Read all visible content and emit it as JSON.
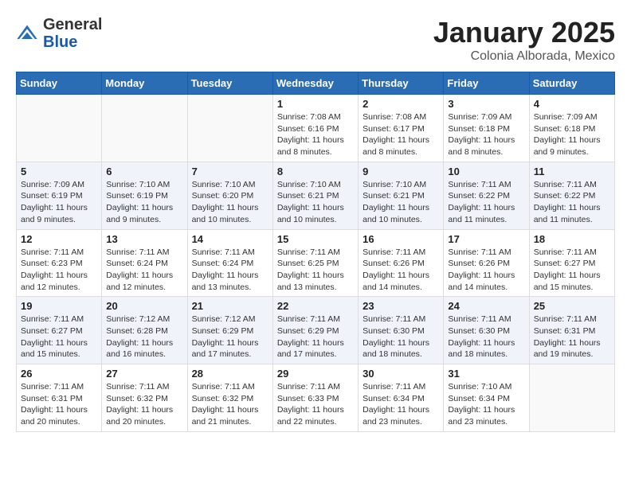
{
  "logo": {
    "general": "General",
    "blue": "Blue"
  },
  "title": "January 2025",
  "subtitle": "Colonia Alborada, Mexico",
  "weekdays": [
    "Sunday",
    "Monday",
    "Tuesday",
    "Wednesday",
    "Thursday",
    "Friday",
    "Saturday"
  ],
  "weeks": [
    [
      {
        "day": "",
        "info": ""
      },
      {
        "day": "",
        "info": ""
      },
      {
        "day": "",
        "info": ""
      },
      {
        "day": "1",
        "info": "Sunrise: 7:08 AM\nSunset: 6:16 PM\nDaylight: 11 hours and 8 minutes."
      },
      {
        "day": "2",
        "info": "Sunrise: 7:08 AM\nSunset: 6:17 PM\nDaylight: 11 hours and 8 minutes."
      },
      {
        "day": "3",
        "info": "Sunrise: 7:09 AM\nSunset: 6:18 PM\nDaylight: 11 hours and 8 minutes."
      },
      {
        "day": "4",
        "info": "Sunrise: 7:09 AM\nSunset: 6:18 PM\nDaylight: 11 hours and 9 minutes."
      }
    ],
    [
      {
        "day": "5",
        "info": "Sunrise: 7:09 AM\nSunset: 6:19 PM\nDaylight: 11 hours and 9 minutes."
      },
      {
        "day": "6",
        "info": "Sunrise: 7:10 AM\nSunset: 6:19 PM\nDaylight: 11 hours and 9 minutes."
      },
      {
        "day": "7",
        "info": "Sunrise: 7:10 AM\nSunset: 6:20 PM\nDaylight: 11 hours and 10 minutes."
      },
      {
        "day": "8",
        "info": "Sunrise: 7:10 AM\nSunset: 6:21 PM\nDaylight: 11 hours and 10 minutes."
      },
      {
        "day": "9",
        "info": "Sunrise: 7:10 AM\nSunset: 6:21 PM\nDaylight: 11 hours and 10 minutes."
      },
      {
        "day": "10",
        "info": "Sunrise: 7:11 AM\nSunset: 6:22 PM\nDaylight: 11 hours and 11 minutes."
      },
      {
        "day": "11",
        "info": "Sunrise: 7:11 AM\nSunset: 6:22 PM\nDaylight: 11 hours and 11 minutes."
      }
    ],
    [
      {
        "day": "12",
        "info": "Sunrise: 7:11 AM\nSunset: 6:23 PM\nDaylight: 11 hours and 12 minutes."
      },
      {
        "day": "13",
        "info": "Sunrise: 7:11 AM\nSunset: 6:24 PM\nDaylight: 11 hours and 12 minutes."
      },
      {
        "day": "14",
        "info": "Sunrise: 7:11 AM\nSunset: 6:24 PM\nDaylight: 11 hours and 13 minutes."
      },
      {
        "day": "15",
        "info": "Sunrise: 7:11 AM\nSunset: 6:25 PM\nDaylight: 11 hours and 13 minutes."
      },
      {
        "day": "16",
        "info": "Sunrise: 7:11 AM\nSunset: 6:26 PM\nDaylight: 11 hours and 14 minutes."
      },
      {
        "day": "17",
        "info": "Sunrise: 7:11 AM\nSunset: 6:26 PM\nDaylight: 11 hours and 14 minutes."
      },
      {
        "day": "18",
        "info": "Sunrise: 7:11 AM\nSunset: 6:27 PM\nDaylight: 11 hours and 15 minutes."
      }
    ],
    [
      {
        "day": "19",
        "info": "Sunrise: 7:11 AM\nSunset: 6:27 PM\nDaylight: 11 hours and 15 minutes."
      },
      {
        "day": "20",
        "info": "Sunrise: 7:12 AM\nSunset: 6:28 PM\nDaylight: 11 hours and 16 minutes."
      },
      {
        "day": "21",
        "info": "Sunrise: 7:12 AM\nSunset: 6:29 PM\nDaylight: 11 hours and 17 minutes."
      },
      {
        "day": "22",
        "info": "Sunrise: 7:11 AM\nSunset: 6:29 PM\nDaylight: 11 hours and 17 minutes."
      },
      {
        "day": "23",
        "info": "Sunrise: 7:11 AM\nSunset: 6:30 PM\nDaylight: 11 hours and 18 minutes."
      },
      {
        "day": "24",
        "info": "Sunrise: 7:11 AM\nSunset: 6:30 PM\nDaylight: 11 hours and 18 minutes."
      },
      {
        "day": "25",
        "info": "Sunrise: 7:11 AM\nSunset: 6:31 PM\nDaylight: 11 hours and 19 minutes."
      }
    ],
    [
      {
        "day": "26",
        "info": "Sunrise: 7:11 AM\nSunset: 6:31 PM\nDaylight: 11 hours and 20 minutes."
      },
      {
        "day": "27",
        "info": "Sunrise: 7:11 AM\nSunset: 6:32 PM\nDaylight: 11 hours and 20 minutes."
      },
      {
        "day": "28",
        "info": "Sunrise: 7:11 AM\nSunset: 6:32 PM\nDaylight: 11 hours and 21 minutes."
      },
      {
        "day": "29",
        "info": "Sunrise: 7:11 AM\nSunset: 6:33 PM\nDaylight: 11 hours and 22 minutes."
      },
      {
        "day": "30",
        "info": "Sunrise: 7:11 AM\nSunset: 6:34 PM\nDaylight: 11 hours and 23 minutes."
      },
      {
        "day": "31",
        "info": "Sunrise: 7:10 AM\nSunset: 6:34 PM\nDaylight: 11 hours and 23 minutes."
      },
      {
        "day": "",
        "info": ""
      }
    ]
  ]
}
